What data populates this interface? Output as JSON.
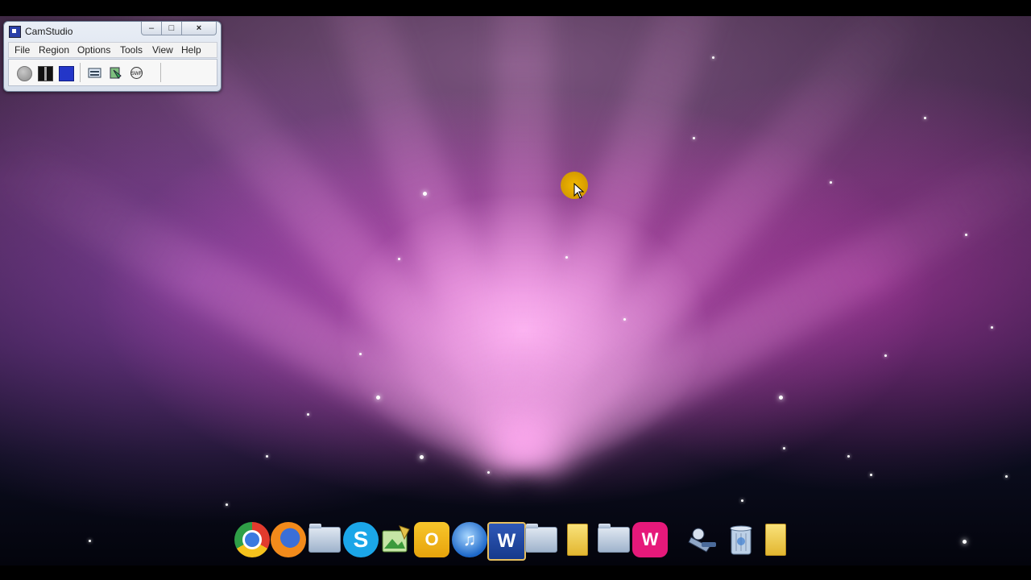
{
  "window": {
    "title": "CamStudio",
    "controls": {
      "minimize": "–",
      "maximize": "□",
      "close": "×"
    }
  },
  "menubar": {
    "items": [
      "File",
      "Region",
      "Options",
      "Tools",
      "View",
      "Help"
    ]
  },
  "toolbar": {
    "buttons": [
      "record-icon",
      "pause-icon",
      "stop-icon",
      "region-icon",
      "annotation-icon",
      "swf-icon"
    ]
  },
  "dock": {
    "icons": [
      "chrome-icon",
      "firefox-icon",
      "folder-icon",
      "skype-icon",
      "image-viewer-icon",
      "outlook-icon",
      "itunes-icon",
      "word-icon",
      "folder-icon",
      "yellow-folder-icon",
      "folder-icon",
      "winamp-icon",
      "tool-icon",
      "trash-icon",
      "yellow-folder-icon"
    ],
    "labels": {
      "skype": "S",
      "outlook": "O",
      "itunes": "♫",
      "word": "W",
      "winamp": "W"
    }
  }
}
